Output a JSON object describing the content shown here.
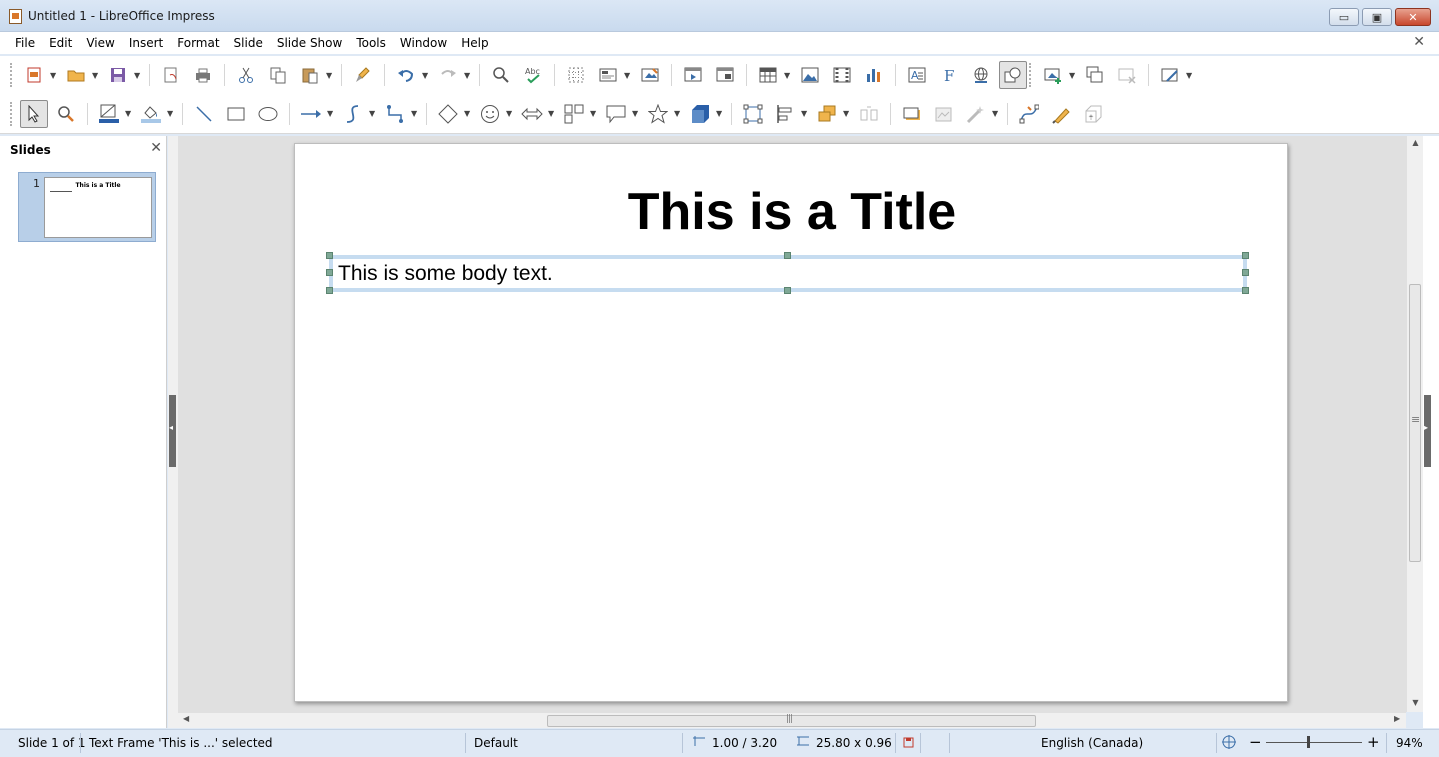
{
  "window": {
    "title": "Untitled 1 - LibreOffice Impress",
    "minimize": "▭",
    "maximize": "▣",
    "close": "✕"
  },
  "menu": [
    {
      "id": "file",
      "label": "File"
    },
    {
      "id": "edit",
      "label": "Edit"
    },
    {
      "id": "view",
      "label": "View"
    },
    {
      "id": "insert",
      "label": "Insert"
    },
    {
      "id": "format",
      "label": "Format"
    },
    {
      "id": "slide",
      "label": "Slide"
    },
    {
      "id": "slideshow",
      "label": "Slide Show"
    },
    {
      "id": "tools",
      "label": "Tools"
    },
    {
      "id": "window",
      "label": "Window"
    },
    {
      "id": "help",
      "label": "Help"
    }
  ],
  "doc_close": "✕",
  "slides_pane": {
    "title": "Slides",
    "close": "✕",
    "thumbnail_number": "1",
    "thumbnail_title": "This is a Title"
  },
  "slide": {
    "title": "This is a Title",
    "body": "This is some body text."
  },
  "status": {
    "slide": "Slide 1 of 1",
    "selection": "Text Frame 'This is ...' selected",
    "master": "Default",
    "position": "1.00 / 3.20",
    "size": "25.80 x 0.96",
    "language": "English (Canada)",
    "zoom_minus": "−",
    "zoom_plus": "+",
    "zoom": "94%"
  },
  "toolbar1_icons": [
    "new-icon",
    "open-icon",
    "save-icon",
    "export-pdf-icon",
    "print-icon",
    "cut-icon",
    "copy-icon",
    "paste-icon",
    "clone-formatting-icon",
    "undo-icon",
    "redo-icon",
    "find-replace-icon",
    "spelling-icon",
    "grid-icon",
    "display-views-icon",
    "master-slide-icon",
    "start-slideshow-icon",
    "slide-layout-icon",
    "table-icon",
    "image-icon",
    "media-icon",
    "chart-icon",
    "textbox-icon",
    "fontwork-icon",
    "hyperlink-icon",
    "draw-functions-icon",
    "new-slide-icon",
    "duplicate-slide-icon",
    "delete-slide-icon",
    "slide-properties-icon"
  ],
  "toolbar2_icons": [
    "select-icon",
    "zoom-pan-icon",
    "line-color-icon",
    "fill-color-icon",
    "line-icon",
    "rectangle-icon",
    "ellipse-icon",
    "arrow-icon",
    "curve-icon",
    "connector-icon",
    "basic-shapes-icon",
    "symbol-shapes-icon",
    "block-arrows-icon",
    "flowchart-icon",
    "callouts-icon",
    "stars-icon",
    "3d-objects-icon",
    "rotate-icon",
    "align-icon",
    "arrange-icon",
    "distribute-icon",
    "shadow-icon",
    "crop-icon",
    "filter-icon",
    "points-icon",
    "glue-points-icon",
    "toggle-extrusion-icon"
  ]
}
